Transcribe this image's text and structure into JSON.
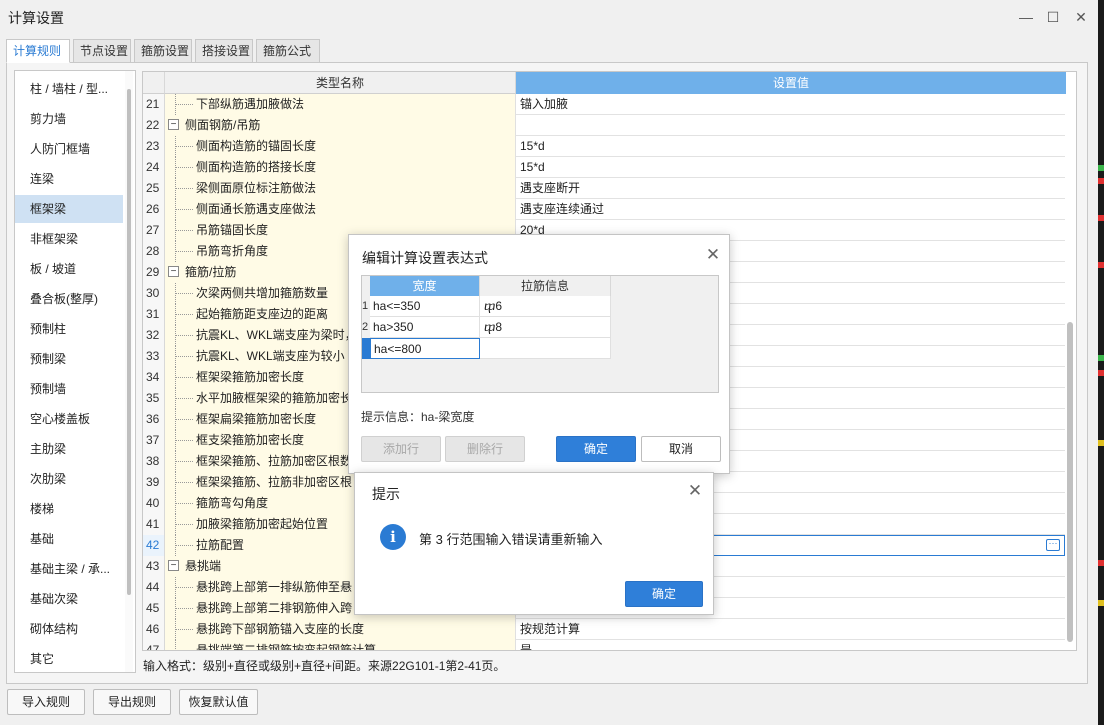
{
  "window": {
    "title": "计算设置",
    "minimize_icon": "—",
    "maximize_icon": "☐",
    "close_icon": "✕"
  },
  "tabs": [
    {
      "label": "计算规则",
      "active": true
    },
    {
      "label": "节点设置"
    },
    {
      "label": "箍筋设置"
    },
    {
      "label": "搭接设置"
    },
    {
      "label": "箍筋公式"
    }
  ],
  "sidebar": {
    "items": [
      {
        "label": "柱 / 墙柱 / 型..."
      },
      {
        "label": "剪力墙"
      },
      {
        "label": "人防门框墙"
      },
      {
        "label": "连梁"
      },
      {
        "label": "框架梁",
        "active": true
      },
      {
        "label": "非框架梁"
      },
      {
        "label": "板 / 坡道"
      },
      {
        "label": "叠合板(整厚)"
      },
      {
        "label": "预制柱"
      },
      {
        "label": "预制梁"
      },
      {
        "label": "预制墙"
      },
      {
        "label": "空心楼盖板"
      },
      {
        "label": "主肋梁"
      },
      {
        "label": "次肋梁"
      },
      {
        "label": "楼梯"
      },
      {
        "label": "基础"
      },
      {
        "label": "基础主梁 / 承..."
      },
      {
        "label": "基础次梁"
      },
      {
        "label": "砌体结构"
      },
      {
        "label": "其它"
      }
    ]
  },
  "grid": {
    "headers": {
      "type": "类型名称",
      "value": "设置值"
    },
    "rows": [
      {
        "num": "21",
        "name": "下部纵筋遇加腋做法",
        "value": "锚入加腋",
        "kind": "child"
      },
      {
        "num": "22",
        "name": "侧面钢筋/吊筋",
        "value": "",
        "kind": "group",
        "toggle": "−"
      },
      {
        "num": "23",
        "name": "侧面构造筋的锚固长度",
        "value": "15*d",
        "kind": "child"
      },
      {
        "num": "24",
        "name": "侧面构造筋的搭接长度",
        "value": "15*d",
        "kind": "child"
      },
      {
        "num": "25",
        "name": "梁侧面原位标注筋做法",
        "value": "遇支座断开",
        "kind": "child"
      },
      {
        "num": "26",
        "name": "侧面通长筋遇支座做法",
        "value": "遇支座连续通过",
        "kind": "child"
      },
      {
        "num": "27",
        "name": "吊筋锚固长度",
        "value": "20*d",
        "kind": "child"
      },
      {
        "num": "28",
        "name": "吊筋弯折角度",
        "value": "",
        "kind": "child"
      },
      {
        "num": "29",
        "name": "箍筋/拉筋",
        "value": "",
        "kind": "group",
        "toggle": "−"
      },
      {
        "num": "30",
        "name": "次梁两侧共增加箍筋数量",
        "value": "",
        "kind": "child"
      },
      {
        "num": "31",
        "name": "起始箍筋距支座边的距离",
        "value": "",
        "kind": "child"
      },
      {
        "num": "32",
        "name": "抗震KL、WKL端支座为梁时，",
        "value": "",
        "kind": "child"
      },
      {
        "num": "33",
        "name": "抗震KL、WKL端支座为较小",
        "value": "",
        "kind": "child"
      },
      {
        "num": "34",
        "name": "框架梁箍筋加密长度",
        "value": "",
        "kind": "child"
      },
      {
        "num": "35",
        "name": "水平加腋框架梁的箍筋加密长",
        "value": "",
        "kind": "child"
      },
      {
        "num": "36",
        "name": "框架扁梁箍筋加密长度",
        "value": "",
        "kind": "child"
      },
      {
        "num": "37",
        "name": "框支梁箍筋加密长度",
        "value": "",
        "kind": "child"
      },
      {
        "num": "38",
        "name": "框架梁箍筋、拉筋加密区根数",
        "value": "",
        "kind": "child"
      },
      {
        "num": "39",
        "name": "框架梁箍筋、拉筋非加密区根",
        "value": "",
        "kind": "child"
      },
      {
        "num": "40",
        "name": "箍筋弯勾角度",
        "value": "",
        "kind": "child"
      },
      {
        "num": "41",
        "name": "加腋梁箍筋加密起始位置",
        "value": "",
        "kind": "child"
      },
      {
        "num": "42",
        "name": "拉筋配置",
        "value": "",
        "kind": "child",
        "selected": true
      },
      {
        "num": "43",
        "name": "悬挑端",
        "value": "",
        "kind": "group",
        "toggle": "−"
      },
      {
        "num": "44",
        "name": "悬挑跨上部第一排纵筋伸至悬",
        "value": "",
        "kind": "child"
      },
      {
        "num": "45",
        "name": "悬挑跨上部第二排钢筋伸入跨",
        "value": "",
        "kind": "child"
      },
      {
        "num": "46",
        "name": "悬挑跨下部钢筋锚入支座的长度",
        "value": "按规范计算",
        "kind": "child"
      },
      {
        "num": "47",
        "name": "悬挑端第二排钢筋按弯起钢筋计算",
        "value": "是",
        "kind": "child"
      }
    ],
    "ellipsis_icon": "···"
  },
  "footer_hint": "输入格式：级别+直径或级别+直径+间距。来源22G101-1第2-41页。",
  "bottom_buttons": {
    "import": "导入规则",
    "export": "导出规则",
    "restore": "恢复默认值"
  },
  "expr_dialog": {
    "title": "编辑计算设置表达式",
    "close_icon": "✕",
    "headers": {
      "width": "宽度",
      "tie": "拉筋信息"
    },
    "rows": [
      {
        "num": "1",
        "width": "ha<=350",
        "tie": "ⴔ6"
      },
      {
        "num": "2",
        "width": "ha>350",
        "tie": "ⴔ8"
      },
      {
        "num": "3",
        "width": "ha<=800",
        "tie": "",
        "editing": true
      }
    ],
    "hint": "提示信息：ha-梁宽度",
    "buttons": {
      "add": "添加行",
      "delete": "删除行",
      "ok": "确定",
      "cancel": "取消"
    }
  },
  "alert_dialog": {
    "title": "提示",
    "close_icon": "✕",
    "icon": "i",
    "message": "第 3 行范围输入错误请重新输入",
    "ok": "确定"
  },
  "colors": {
    "accent": "#2a7bd3",
    "header_blue": "#6fb0ea",
    "type_cell_bg": "#fffbe6",
    "selected_sidebar": "#cfe1f3"
  }
}
